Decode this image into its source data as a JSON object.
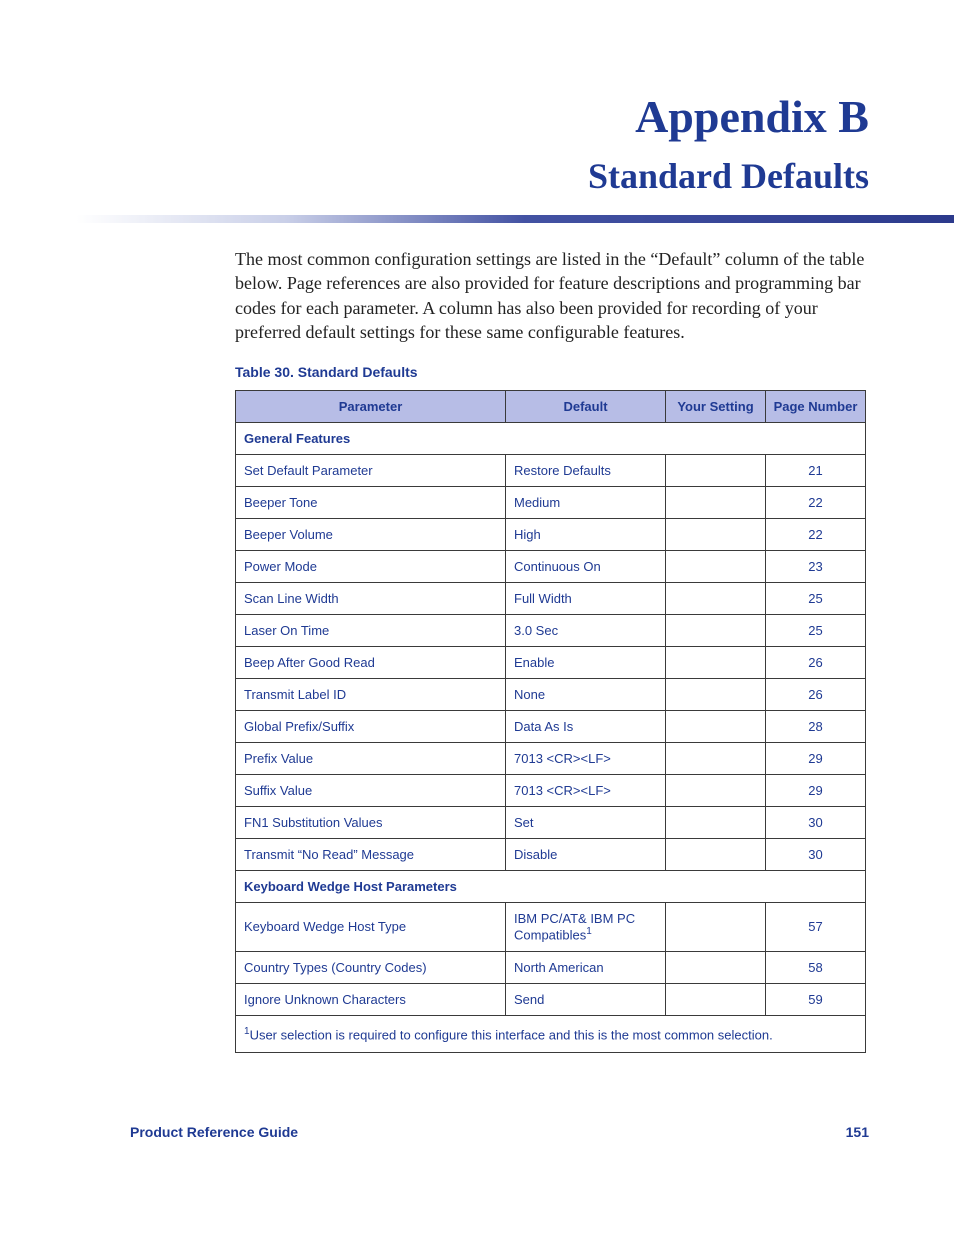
{
  "title": "Appendix B",
  "subtitle": "Standard Defaults",
  "intro": "The most common configuration settings are listed in the “Default” column of the table below. Page references are also provided for feature descriptions and programming bar codes for each parameter. A column has also been provided for recording of your preferred default settings for these same configurable features.",
  "table_caption": "Table 30. Standard Defaults",
  "headers": {
    "parameter": "Parameter",
    "default": "Default",
    "your_setting": "Your Setting",
    "page_number": "Page Number"
  },
  "sections": [
    {
      "name": "General Features",
      "rows": [
        {
          "param": "Set Default Parameter",
          "default": "Restore Defaults",
          "your": "",
          "page": "21"
        },
        {
          "param": "Beeper Tone",
          "default": "Medium",
          "your": "",
          "page": "22"
        },
        {
          "param": "Beeper Volume",
          "default": "High",
          "your": "",
          "page": "22"
        },
        {
          "param": "Power Mode",
          "default": "Continuous On",
          "your": "",
          "page": "23"
        },
        {
          "param": "Scan Line Width",
          "default": "Full Width",
          "your": "",
          "page": "25"
        },
        {
          "param": "Laser On Time",
          "default": "3.0 Sec",
          "your": "",
          "page": "25"
        },
        {
          "param": "Beep After Good Read",
          "default": "Enable",
          "your": "",
          "page": "26"
        },
        {
          "param": "Transmit  Label ID",
          "default": "None",
          "your": "",
          "page": "26"
        },
        {
          "param": "Global Prefix/Suffix",
          "default": "Data As Is",
          "your": "",
          "page": "28"
        },
        {
          "param": "Prefix Value",
          "default": "7013 <CR><LF>",
          "your": "",
          "page": "29"
        },
        {
          "param": "Suffix Value",
          "default": "7013 <CR><LF>",
          "your": "",
          "page": "29"
        },
        {
          "param": "FN1 Substitution Values",
          "default": "Set",
          "your": "",
          "page": "30"
        },
        {
          "param": "Transmit “No Read” Message",
          "default": "Disable",
          "your": "",
          "page": "30"
        }
      ]
    },
    {
      "name": "Keyboard Wedge Host Parameters",
      "rows": [
        {
          "param": "Keyboard Wedge Host Type",
          "default_html": "IBM PC/AT& IBM PC Compatibles<sup>1</sup>",
          "your": "",
          "page": "57"
        },
        {
          "param": "Country Types (Country Codes)",
          "default": "North American",
          "your": "",
          "page": "58"
        },
        {
          "param": "Ignore Unknown Characters",
          "default": "Send",
          "your": "",
          "page": "59"
        }
      ]
    }
  ],
  "footnote_html": "<sup>1</sup>User selection is required to configure this interface and this is the most common selection.",
  "footer": {
    "left": "Product Reference Guide",
    "right": "151"
  }
}
